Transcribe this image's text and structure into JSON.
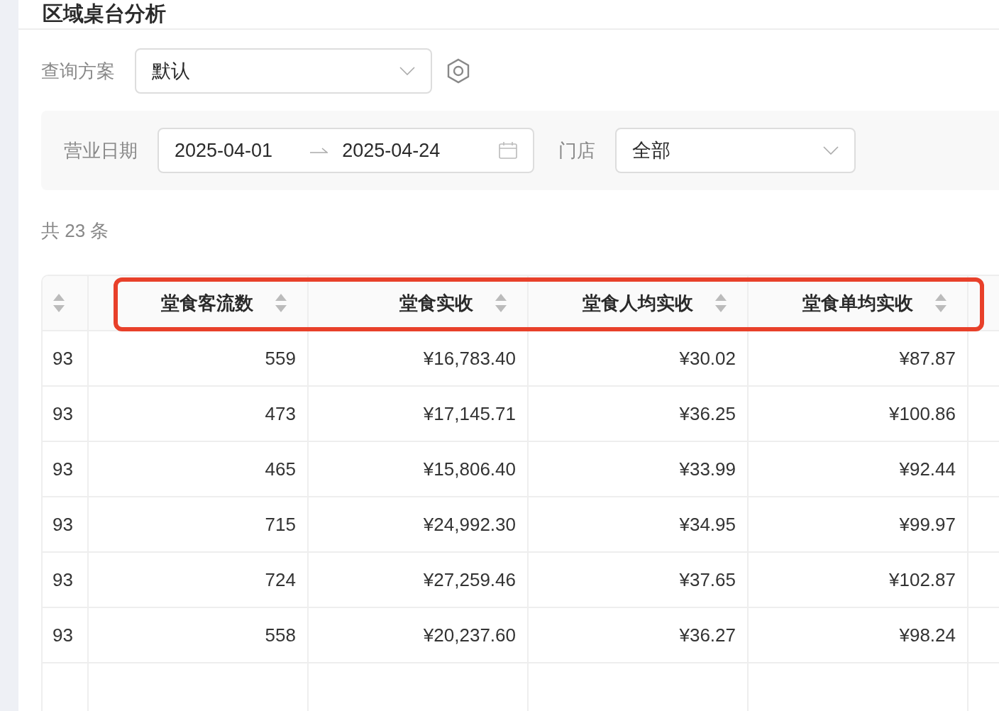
{
  "page": {
    "title": "区域桌台分析"
  },
  "query_scheme": {
    "label": "查询方案",
    "value": "默认"
  },
  "filters": {
    "date": {
      "label": "营业日期",
      "start": "2025-04-01",
      "end": "2025-04-24"
    },
    "store": {
      "label": "门店",
      "value": "全部"
    }
  },
  "total": "共 23 条",
  "table": {
    "columns": [
      "堂食客流数",
      "堂食实收",
      "堂食人均实收",
      "堂食单均实收"
    ],
    "rows": [
      {
        "column_1": "93",
        "cells": [
          "559",
          "¥16,783.40",
          "¥30.02",
          "¥87.87"
        ]
      },
      {
        "column_1": "93",
        "cells": [
          "473",
          "¥17,145.71",
          "¥36.25",
          "¥100.86"
        ]
      },
      {
        "column_1": "93",
        "cells": [
          "465",
          "¥15,806.40",
          "¥33.99",
          "¥92.44"
        ]
      },
      {
        "column_1": "93",
        "cells": [
          "715",
          "¥24,992.30",
          "¥34.95",
          "¥99.97"
        ]
      },
      {
        "column_1": "93",
        "cells": [
          "724",
          "¥27,259.46",
          "¥37.65",
          "¥102.87"
        ]
      },
      {
        "column_1": "93",
        "cells": [
          "558",
          "¥20,237.60",
          "¥36.27",
          "¥98.24"
        ]
      }
    ]
  }
}
